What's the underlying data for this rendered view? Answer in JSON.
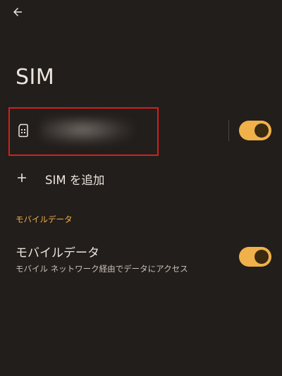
{
  "header": {
    "back_icon": "arrow-back-icon",
    "title": "SIM"
  },
  "sim_list": {
    "sim_icon": "sim-card-icon",
    "sim_name": "",
    "sim_name_obscured": true,
    "enabled": true
  },
  "add_sim": {
    "icon": "plus-icon",
    "label": "SIM を追加"
  },
  "mobile_data_section": {
    "header": "モバイルデータ",
    "title": "モバイルデータ",
    "subtitle": "モバイル ネットワーク経由でデータにアクセス",
    "enabled": true
  },
  "colors": {
    "background": "#221e1b",
    "accent": "#f0b14a",
    "toggle_knob": "#3b2a12",
    "highlight_box": "#d21f1f",
    "text_primary": "#ece5dd"
  }
}
